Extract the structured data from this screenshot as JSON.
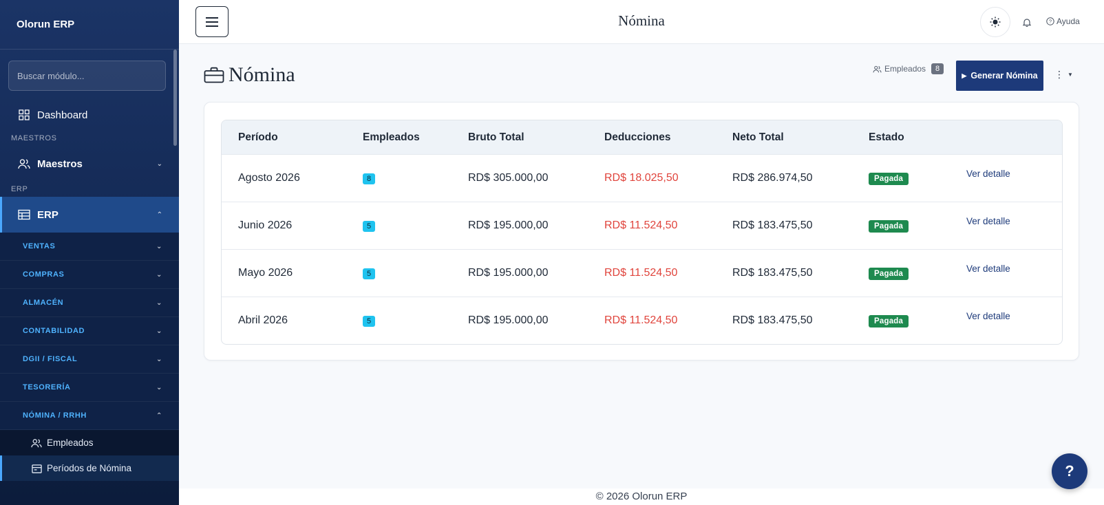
{
  "app": {
    "brand": "Olorun ERP"
  },
  "sidebar": {
    "search_placeholder": "Buscar módulo...",
    "dashboard": "Dashboard",
    "sections": {
      "maestros": "MAESTROS",
      "erp": "ERP"
    },
    "maestros_group": "Maestros",
    "erp_group": "ERP",
    "subgroups": [
      "VENTAS",
      "COMPRAS",
      "ALMACÉN",
      "CONTABILIDAD",
      "DGII / FISCAL",
      "TESORERÍA",
      "NÓMINA / RRHH"
    ],
    "nomina_items": [
      "Empleados",
      "Períodos de Nómina"
    ]
  },
  "header": {
    "title": "Nómina",
    "help": "Ayuda"
  },
  "page": {
    "title": "Nómina",
    "employees_label": "Empleados",
    "employees_count": "8",
    "generate_button": "Generar Nómina"
  },
  "table": {
    "columns": [
      "Período",
      "Empleados",
      "Bruto Total",
      "Deducciones",
      "Neto Total",
      "Estado",
      ""
    ],
    "rows": [
      {
        "period": "Agosto 2026",
        "employees": "8",
        "gross": "RD$ 305.000,00",
        "deductions": "RD$ 18.025,50",
        "net": "RD$ 286.974,50",
        "status": "Pagada",
        "action": "Ver detalle"
      },
      {
        "period": "Junio 2026",
        "employees": "5",
        "gross": "RD$ 195.000,00",
        "deductions": "RD$ 11.524,50",
        "net": "RD$ 183.475,50",
        "status": "Pagada",
        "action": "Ver detalle"
      },
      {
        "period": "Mayo 2026",
        "employees": "5",
        "gross": "RD$ 195.000,00",
        "deductions": "RD$ 11.524,50",
        "net": "RD$ 183.475,50",
        "status": "Pagada",
        "action": "Ver detalle"
      },
      {
        "period": "Abril 2026",
        "employees": "5",
        "gross": "RD$ 195.000,00",
        "deductions": "RD$ 11.524,50",
        "net": "RD$ 183.475,50",
        "status": "Pagada",
        "action": "Ver detalle"
      }
    ]
  },
  "footer": {
    "text": "© 2026 Olorun ERP"
  },
  "fab": {
    "label": "?"
  },
  "colors": {
    "primary": "#1d3a7a",
    "status_paid": "#1e8a4f",
    "deduction": "#e0443c",
    "count_badge": "#1fc3ef"
  }
}
